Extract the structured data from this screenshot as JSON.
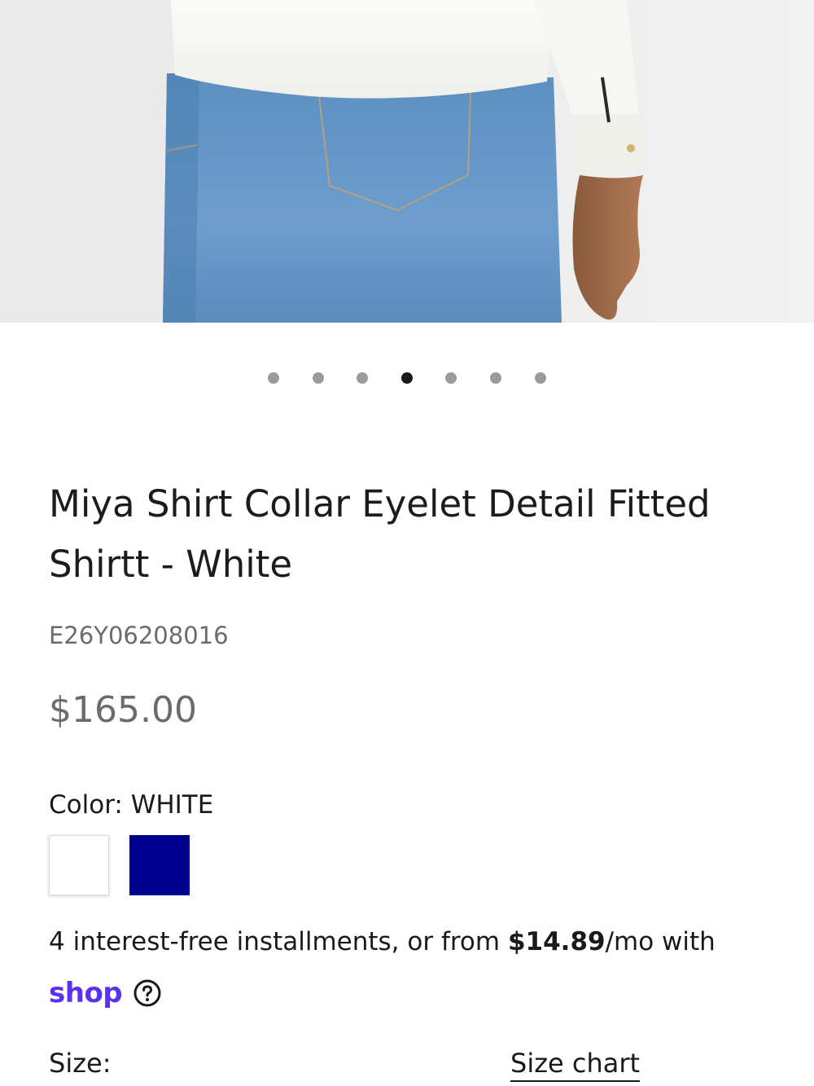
{
  "hero": {
    "alt": "Model wearing white fitted shirt with light blue jeans, back view"
  },
  "carousel": {
    "count": 7,
    "active_index": 3
  },
  "product": {
    "title": "Miya Shirt Collar Eyelet Detail Fitted Shirtt - White",
    "sku": "E26Y06208016",
    "price": "$165.00"
  },
  "color": {
    "label": "Color: WHITE",
    "swatches": [
      {
        "name": "White",
        "hex": "#ffffff",
        "selected": true
      },
      {
        "name": "Navy",
        "hex": "#00008f",
        "selected": false
      }
    ]
  },
  "installments": {
    "prefix": "4 interest-free installments, or from ",
    "amount": "$14.89",
    "suffix": "/mo with",
    "brand": "shop",
    "help_icon": "question-circle-icon"
  },
  "size": {
    "label": "Size:",
    "chart_link": "Size chart"
  }
}
